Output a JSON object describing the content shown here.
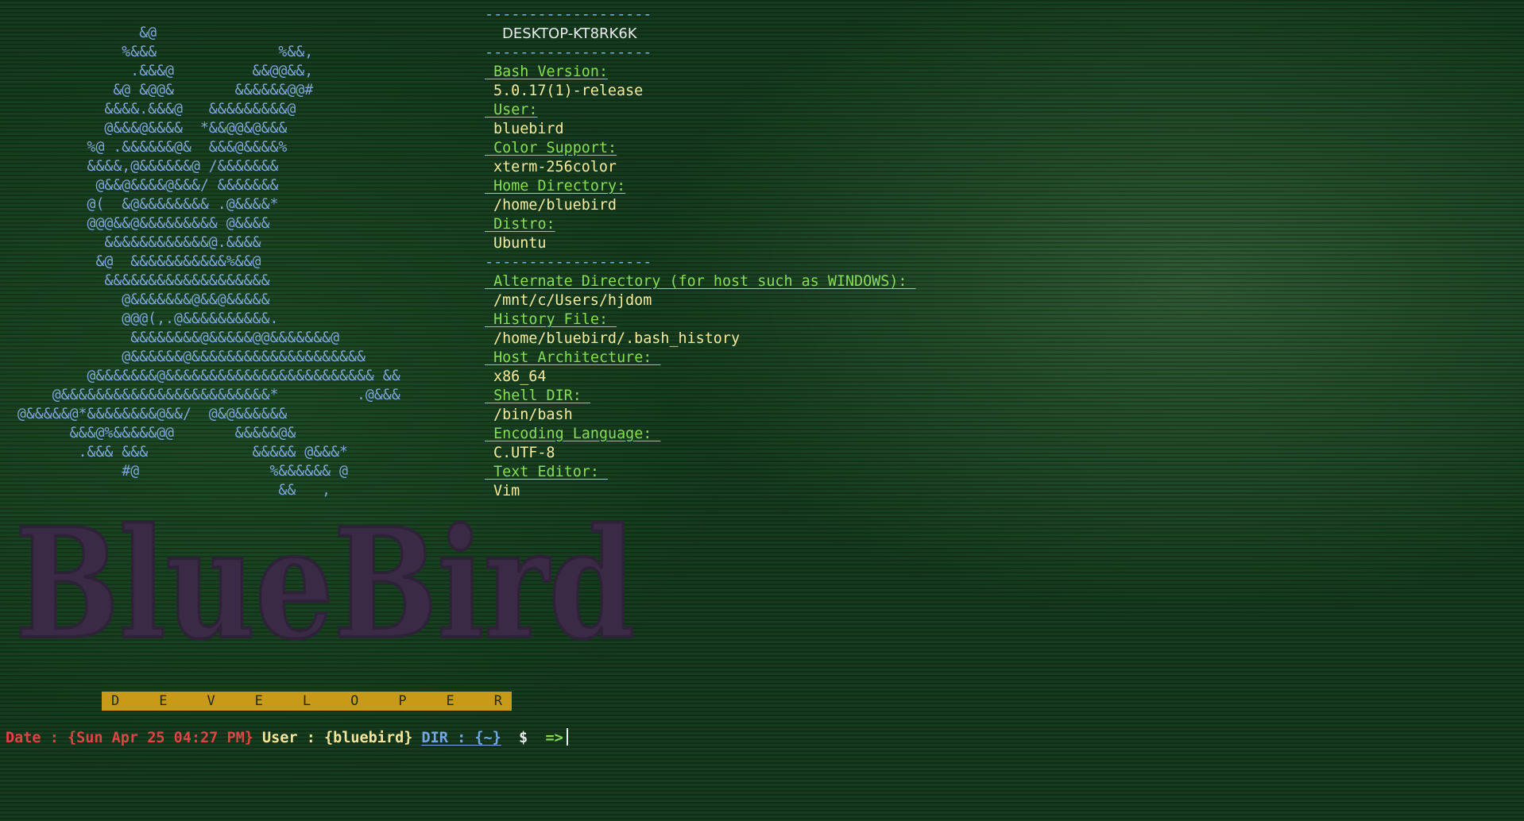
{
  "ascii_art": [
    "                &@",
    "              %&&&              %&&,",
    "               .&&&@         &&@@&&,",
    "             &@ &@@&       &&&&&&@@#",
    "            &&&&.&&&@   &&&&&&&&&@",
    "            @&&&@&&&&  *&&@@&@&&&",
    "          %@ .&&&&&&@&  &&&@&&&&%",
    "          &&&&,@&&&&&&@ /&&&&&&&",
    "           @&&@&&&&@&&&/ &&&&&&&",
    "          @(  &@&&&&&&&& .@&&&&*",
    "          @@@&&@&&&&&&&&& @&&&&",
    "            &&&&&&&&&&&&@.&&&&",
    "           &@  &&&&&&&&&&&%&&@",
    "            &&&&&&&&&&&&&&&&&&&",
    "              @&&&&&&&@&&@&&&&&",
    "              @@@(,.@&&&&&&&&&&.",
    "               &&&&&&&&@&&&&&@@&&&&&&&@",
    "              @&&&&&&@&&&&&&&&&&&&&&&&&&&&",
    "          @&&&&&&&@&&&&&&&&&&&&&&&&&&&&&&&& &&",
    "      @&&&&&&&&&&&&&&&&&&&&&&&&*         .@&&&",
    "  @&&&&&@*&&&&&&&&@&&/  @&@&&&&&&",
    "        &&&@%&&&&&@@       &&&&&@&",
    "         .&&& &&&            &&&&& @&&&*",
    "              #@               %&&&&&& @",
    "                                &&   ,"
  ],
  "info": {
    "separator": "-------------------",
    "hostname": "DESKTOP-KT8RK6K",
    "fields_top": [
      {
        "label": "Bash Version:",
        "value": "5.0.17(1)-release"
      },
      {
        "label": "User:",
        "value": "bluebird"
      },
      {
        "label": "Color Support:",
        "value": "xterm-256color"
      },
      {
        "label": "Home Directory:",
        "value": "/home/bluebird"
      },
      {
        "label": "Distro:",
        "value": "Ubuntu"
      }
    ],
    "fields_bottom": [
      {
        "label": "Alternate Directory (for host such as WINDOWS):",
        "value": "/mnt/c/Users/hjdom"
      },
      {
        "label": "History File:",
        "value": "/home/bluebird/.bash_history"
      },
      {
        "label": "Host Architecture:",
        "value": "x86_64"
      },
      {
        "label": "Shell DIR:",
        "value": "/bin/bash"
      },
      {
        "label": "Encoding Language:",
        "value": "C.UTF-8"
      },
      {
        "label": "Text Editor:",
        "value": "Vim"
      }
    ]
  },
  "logo": {
    "text": "BlueBird",
    "color": "#3a2a45"
  },
  "banner": {
    "letters": [
      "D",
      "E",
      "V",
      "E",
      "L",
      "O",
      "P",
      "E",
      "R"
    ],
    "color": "#c99a17"
  },
  "prompt": {
    "date": "Date : {Sun Apr 25 04:27 PM}",
    "user": "User : {bluebird}",
    "dir": "DIR : {~}",
    "dollar": "$",
    "arrow": "=>"
  },
  "colors": {
    "label": "#86dd58",
    "value": "#f6ea9c",
    "ascii": "#7fa6d6",
    "date": "#e04444"
  }
}
